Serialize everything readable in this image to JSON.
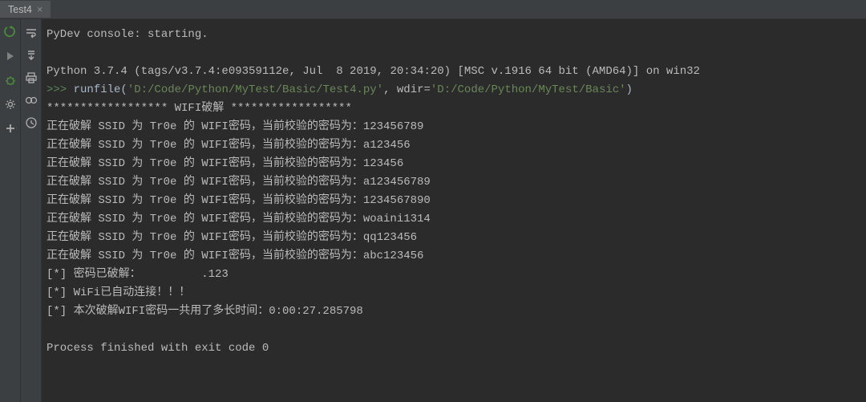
{
  "tab": {
    "name": "Test4",
    "close_glyph": "×"
  },
  "console": {
    "line1": "PyDev console: starting.",
    "line2": "Python 3.7.4 (tags/v3.7.4:e09359112e, Jul  8 2019, 20:34:20) [MSC v.1916 64 bit (AMD64)] on win32",
    "prompt": ">>> ",
    "runfile_func": "runfile(",
    "runfile_arg1": "'D:/Code/Python/MyTest/Basic/Test4.py'",
    "runfile_sep": ", wdir=",
    "runfile_arg2": "'D:/Code/Python/MyTest/Basic'",
    "runfile_close": ")",
    "wifi_header": "****************** WIFI破解 ******************",
    "attempts": [
      "正在破解 SSID 为 Tr0e 的 WIFI密码，当前校验的密码为：123456789",
      "正在破解 SSID 为 Tr0e 的 WIFI密码，当前校验的密码为：a123456",
      "正在破解 SSID 为 Tr0e 的 WIFI密码，当前校验的密码为：123456",
      "正在破解 SSID 为 Tr0e 的 WIFI密码，当前校验的密码为：a123456789",
      "正在破解 SSID 为 Tr0e 的 WIFI密码，当前校验的密码为：1234567890",
      "正在破解 SSID 为 Tr0e 的 WIFI密码，当前校验的密码为：woaini1314",
      "正在破解 SSID 为 Tr0e 的 WIFI密码，当前校验的密码为：qq123456",
      "正在破解 SSID 为 Tr0e 的 WIFI密码，当前校验的密码为：abc123456"
    ],
    "result1": "[*] 密码已破解：         .123",
    "result2": "[*] WiFi已自动连接！！！",
    "result3": "[*] 本次破解WIFI密码一共用了多长时间：0:00:27.285798",
    "exit_line": "Process finished with exit code 0"
  }
}
